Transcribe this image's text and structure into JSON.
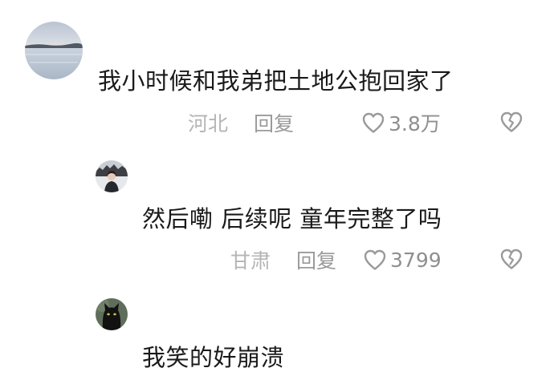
{
  "comments": [
    {
      "avatar_icon": "lake-landscape-avatar",
      "text": "我小时候和我弟把土地公抱回家了",
      "location": "河北",
      "reply_label": "回复",
      "like_count": "3.8万"
    },
    {
      "avatar_icon": "person-snow-avatar",
      "text": "然后嘞 后续呢 童年完整了吗",
      "location": "甘肃",
      "reply_label": "回复",
      "like_count": "3799"
    },
    {
      "avatar_icon": "black-cat-avatar",
      "text": "我笑的好崩溃"
    }
  ],
  "colors": {
    "text": "#1a1a1a",
    "meta": "#a8a8a8",
    "icon": "#9a9a9a"
  }
}
